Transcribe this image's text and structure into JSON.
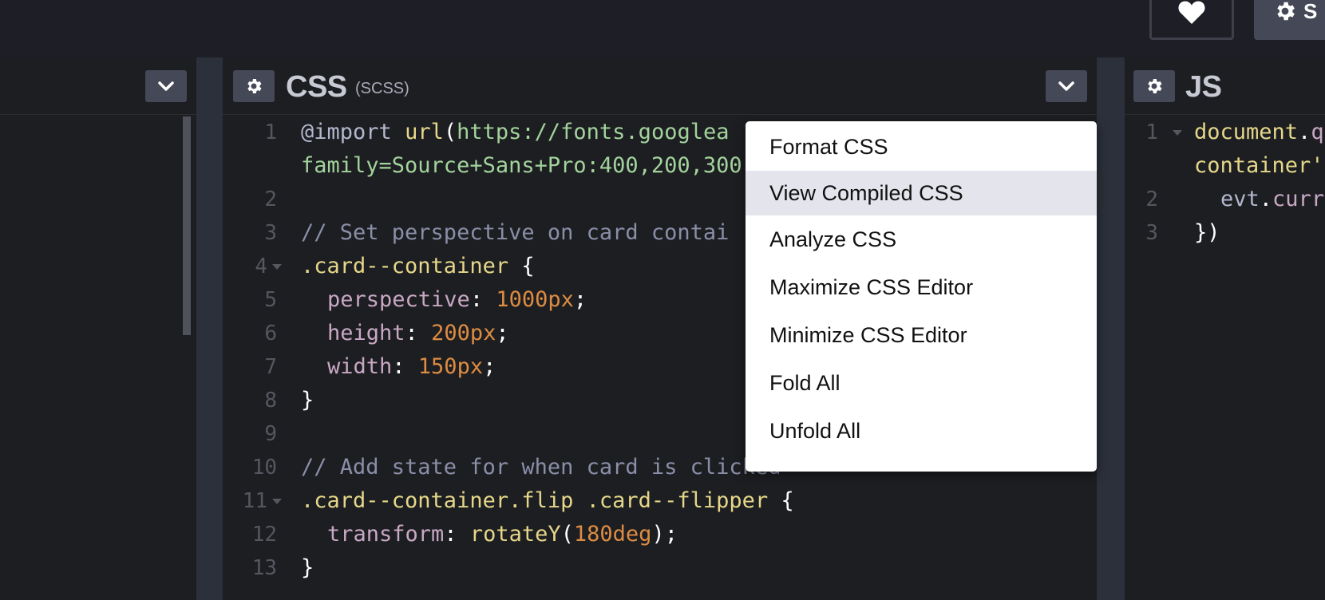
{
  "css_panel": {
    "title": "CSS",
    "subtitle": "(SCSS)"
  },
  "js_panel": {
    "title": "JS"
  },
  "settings_label": "S",
  "css_code": {
    "line_numbers": [
      "1",
      "",
      "2",
      "3",
      "4",
      "5",
      "6",
      "7",
      "8",
      "9",
      "10",
      "11",
      "12",
      "13"
    ],
    "l1_kw": "@import",
    "l1_fn": "url",
    "l1_paren": "(",
    "l1_str": "https://fonts.googlea",
    "l1b_str": "family=Source+Sans+Pro:400,200,300",
    "l3": "// Set perspective on card contai",
    "l4_sel": ".card--container",
    "l4_brace": " {",
    "l5_prop": "perspective",
    "l5_colon": ": ",
    "l5_val": "1000px",
    "l5_semi": ";",
    "l6_prop": "height",
    "l6_colon": ": ",
    "l6_val": "200px",
    "l6_semi": ";",
    "l7_prop": "width",
    "l7_colon": ": ",
    "l7_val": "150px",
    "l7_semi": ";",
    "l8": "}",
    "l10": "// Add state for when card is clicked",
    "l11_sel": ".card--container.flip .card--flipper",
    "l11_brace": " {",
    "l12_prop": "transform",
    "l12_colon": ": ",
    "l12_fn": "rotateY",
    "l12_paren1": "(",
    "l12_val": "180deg",
    "l12_end": ");",
    "l13": "}"
  },
  "js_code": {
    "line_numbers": [
      "1",
      "",
      "2",
      "3"
    ],
    "l1_obj": "document",
    "l1_dot": ".",
    "l1_rest": "q",
    "l1b": "container'",
    "l2_var": "evt",
    "l2_dot": ".",
    "l2_rest": "curr",
    "l3": "})"
  },
  "menu": {
    "items": [
      "Format CSS",
      "View Compiled CSS",
      "Analyze CSS",
      "Maximize CSS Editor",
      "Minimize CSS Editor",
      "Fold All",
      "Unfold All"
    ],
    "active_index": 1
  },
  "colors": {
    "accent_menu_hover": "#e4e5ec",
    "editor_bg": "#1d1e22",
    "string": "#a3d39c",
    "number": "#dd8c42",
    "selector": "#e5d789",
    "comment": "#8a8fa8"
  },
  "icons": {
    "heart": "heart-icon",
    "gear": "gear-icon",
    "chevron": "chevron-down-icon"
  }
}
